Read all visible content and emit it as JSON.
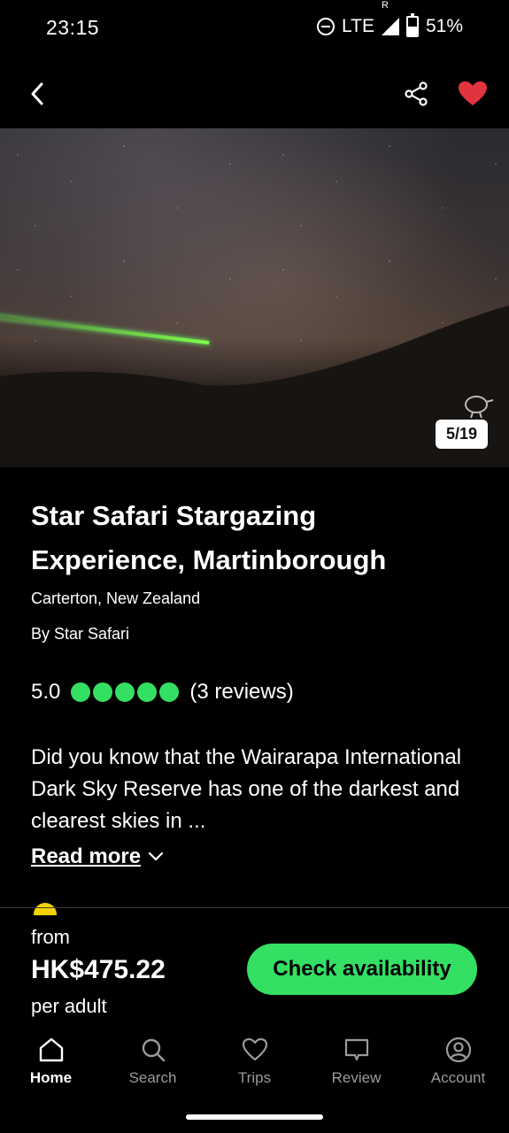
{
  "status": {
    "time": "23:15",
    "network": "LTE",
    "roaming": "R",
    "battery": "51%",
    "battery_level": 0.51
  },
  "nav": {
    "back_icon": "back-arrow-icon",
    "share_icon": "share-icon",
    "favorite_icon": "heart-icon",
    "favorite_color": "#e0353f"
  },
  "hero": {
    "counter": "5/19"
  },
  "listing": {
    "title": "Star Safari Stargazing Experience, Martinborough",
    "location": "Carterton, New Zealand",
    "operator": "By Star Safari",
    "rating": "5.0",
    "rating_bubbles": 5,
    "reviews": "(3 reviews)",
    "description": "Did you know that the Wairarapa International Dark Sky Reserve has one of the darkest and clearest skies in ...",
    "read_more": "Read more"
  },
  "pricing": {
    "from": "from",
    "price": "HK$475.22",
    "per": "per adult",
    "cta": "Check availability",
    "accent": "#34e063"
  },
  "tabs": [
    {
      "label": "Home",
      "icon": "home-icon",
      "active": true
    },
    {
      "label": "Search",
      "icon": "search-icon",
      "active": false
    },
    {
      "label": "Trips",
      "icon": "heart-outline-icon",
      "active": false
    },
    {
      "label": "Review",
      "icon": "review-icon",
      "active": false
    },
    {
      "label": "Account",
      "icon": "account-icon",
      "active": false
    }
  ]
}
